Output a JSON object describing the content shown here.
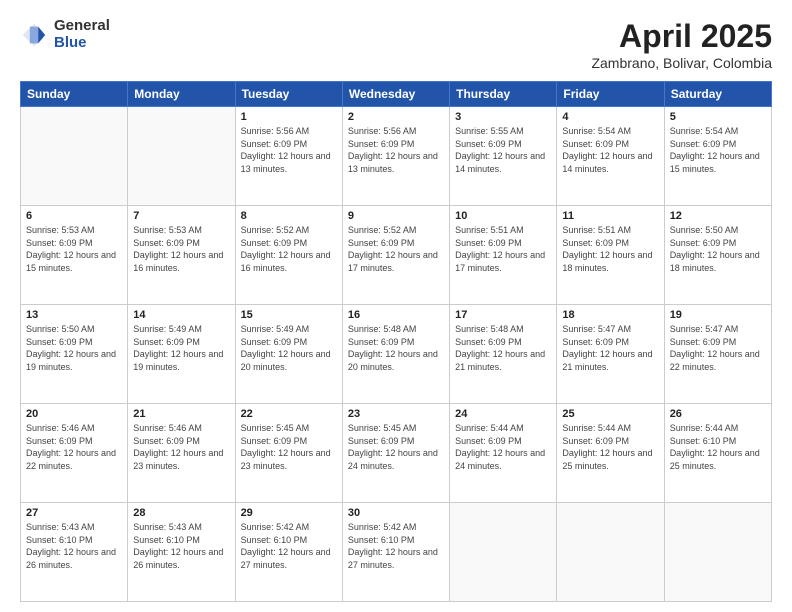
{
  "header": {
    "logo_general": "General",
    "logo_blue": "Blue",
    "month_title": "April 2025",
    "location": "Zambrano, Bolivar, Colombia"
  },
  "days_of_week": [
    "Sunday",
    "Monday",
    "Tuesday",
    "Wednesday",
    "Thursday",
    "Friday",
    "Saturday"
  ],
  "weeks": [
    [
      {
        "num": "",
        "info": ""
      },
      {
        "num": "",
        "info": ""
      },
      {
        "num": "1",
        "info": "Sunrise: 5:56 AM\nSunset: 6:09 PM\nDaylight: 12 hours and 13 minutes."
      },
      {
        "num": "2",
        "info": "Sunrise: 5:56 AM\nSunset: 6:09 PM\nDaylight: 12 hours and 13 minutes."
      },
      {
        "num": "3",
        "info": "Sunrise: 5:55 AM\nSunset: 6:09 PM\nDaylight: 12 hours and 14 minutes."
      },
      {
        "num": "4",
        "info": "Sunrise: 5:54 AM\nSunset: 6:09 PM\nDaylight: 12 hours and 14 minutes."
      },
      {
        "num": "5",
        "info": "Sunrise: 5:54 AM\nSunset: 6:09 PM\nDaylight: 12 hours and 15 minutes."
      }
    ],
    [
      {
        "num": "6",
        "info": "Sunrise: 5:53 AM\nSunset: 6:09 PM\nDaylight: 12 hours and 15 minutes."
      },
      {
        "num": "7",
        "info": "Sunrise: 5:53 AM\nSunset: 6:09 PM\nDaylight: 12 hours and 16 minutes."
      },
      {
        "num": "8",
        "info": "Sunrise: 5:52 AM\nSunset: 6:09 PM\nDaylight: 12 hours and 16 minutes."
      },
      {
        "num": "9",
        "info": "Sunrise: 5:52 AM\nSunset: 6:09 PM\nDaylight: 12 hours and 17 minutes."
      },
      {
        "num": "10",
        "info": "Sunrise: 5:51 AM\nSunset: 6:09 PM\nDaylight: 12 hours and 17 minutes."
      },
      {
        "num": "11",
        "info": "Sunrise: 5:51 AM\nSunset: 6:09 PM\nDaylight: 12 hours and 18 minutes."
      },
      {
        "num": "12",
        "info": "Sunrise: 5:50 AM\nSunset: 6:09 PM\nDaylight: 12 hours and 18 minutes."
      }
    ],
    [
      {
        "num": "13",
        "info": "Sunrise: 5:50 AM\nSunset: 6:09 PM\nDaylight: 12 hours and 19 minutes."
      },
      {
        "num": "14",
        "info": "Sunrise: 5:49 AM\nSunset: 6:09 PM\nDaylight: 12 hours and 19 minutes."
      },
      {
        "num": "15",
        "info": "Sunrise: 5:49 AM\nSunset: 6:09 PM\nDaylight: 12 hours and 20 minutes."
      },
      {
        "num": "16",
        "info": "Sunrise: 5:48 AM\nSunset: 6:09 PM\nDaylight: 12 hours and 20 minutes."
      },
      {
        "num": "17",
        "info": "Sunrise: 5:48 AM\nSunset: 6:09 PM\nDaylight: 12 hours and 21 minutes."
      },
      {
        "num": "18",
        "info": "Sunrise: 5:47 AM\nSunset: 6:09 PM\nDaylight: 12 hours and 21 minutes."
      },
      {
        "num": "19",
        "info": "Sunrise: 5:47 AM\nSunset: 6:09 PM\nDaylight: 12 hours and 22 minutes."
      }
    ],
    [
      {
        "num": "20",
        "info": "Sunrise: 5:46 AM\nSunset: 6:09 PM\nDaylight: 12 hours and 22 minutes."
      },
      {
        "num": "21",
        "info": "Sunrise: 5:46 AM\nSunset: 6:09 PM\nDaylight: 12 hours and 23 minutes."
      },
      {
        "num": "22",
        "info": "Sunrise: 5:45 AM\nSunset: 6:09 PM\nDaylight: 12 hours and 23 minutes."
      },
      {
        "num": "23",
        "info": "Sunrise: 5:45 AM\nSunset: 6:09 PM\nDaylight: 12 hours and 24 minutes."
      },
      {
        "num": "24",
        "info": "Sunrise: 5:44 AM\nSunset: 6:09 PM\nDaylight: 12 hours and 24 minutes."
      },
      {
        "num": "25",
        "info": "Sunrise: 5:44 AM\nSunset: 6:09 PM\nDaylight: 12 hours and 25 minutes."
      },
      {
        "num": "26",
        "info": "Sunrise: 5:44 AM\nSunset: 6:10 PM\nDaylight: 12 hours and 25 minutes."
      }
    ],
    [
      {
        "num": "27",
        "info": "Sunrise: 5:43 AM\nSunset: 6:10 PM\nDaylight: 12 hours and 26 minutes."
      },
      {
        "num": "28",
        "info": "Sunrise: 5:43 AM\nSunset: 6:10 PM\nDaylight: 12 hours and 26 minutes."
      },
      {
        "num": "29",
        "info": "Sunrise: 5:42 AM\nSunset: 6:10 PM\nDaylight: 12 hours and 27 minutes."
      },
      {
        "num": "30",
        "info": "Sunrise: 5:42 AM\nSunset: 6:10 PM\nDaylight: 12 hours and 27 minutes."
      },
      {
        "num": "",
        "info": ""
      },
      {
        "num": "",
        "info": ""
      },
      {
        "num": "",
        "info": ""
      }
    ]
  ]
}
